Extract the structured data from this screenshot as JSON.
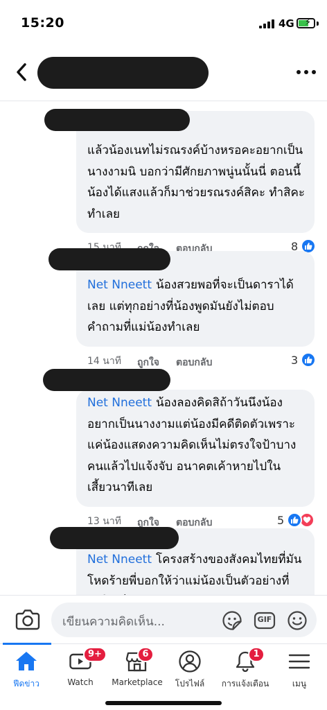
{
  "status_bar": {
    "time": "15:20",
    "network": "4G"
  },
  "comments": [
    {
      "author": "",
      "text": "แล้วน้องเนทไม่รณรงค์บ้างหรอคะอยากเป็นนางงามนิ บอกว่ามีศักยภาพนู่นนั้นนี่ ตอนนี้น้องได้แสงแล้วก็มาช่วยรณรงค์สิคะ ทำสิคะทำเลย",
      "time": "15 นาที",
      "like_label": "ถูกใจ",
      "reply_label": "ตอบกลับ",
      "reaction_count": "8",
      "reactions": [
        "like"
      ]
    },
    {
      "author": "Net Nneett",
      "text": "น้องสวยพอที่จะเป็นดาราได้เลย แต่ทุกอย่างที่น้องพูดมันยังไม่ตอบคำถามที่แม่น้องทำเลย",
      "time": "14 นาที",
      "like_label": "ถูกใจ",
      "reply_label": "ตอบกลับ",
      "reaction_count": "3",
      "reactions": [
        "like"
      ]
    },
    {
      "author": "Net Nneett",
      "text": "น้องลองคิดสิถ้าวันนึงน้องอยากเป็นนางงามแต่น้องมีคดีติดตัวเพราะแค่น้องแสดงความคิดเห็นไม่ตรงใจป้าบางคนแล้วไปแจ้งจับ อนาคตเค้าหายไปในเสี้ยวนาทีเลย",
      "time": "13 นาที",
      "like_label": "ถูกใจ",
      "reply_label": "ตอบกลับ",
      "reaction_count": "5",
      "reactions": [
        "like",
        "love"
      ]
    },
    {
      "author": "Net Nneett",
      "text": "โครงสร้างของสังคมไทยที่มันโหดร้ายพี่บอกให้ว่าแม่น้องเป็นตัวอย่างที่ทำให้เห็นชัดเจน",
      "time": "",
      "like_label": "",
      "reply_label": "",
      "reaction_count": "",
      "reactions": []
    }
  ],
  "composer": {
    "placeholder": "เขียนความคิดเห็น...",
    "gif_label": "GIF"
  },
  "tabs": [
    {
      "label": "ฟีดข่าว",
      "icon": "home-icon",
      "badge": "",
      "active": true
    },
    {
      "label": "Watch",
      "icon": "watch-icon",
      "badge": "9+"
    },
    {
      "label": "Marketplace",
      "icon": "marketplace-icon",
      "badge": "6"
    },
    {
      "label": "โปรไฟล์",
      "icon": "profile-icon",
      "badge": ""
    },
    {
      "label": "การแจ้งเตือน",
      "icon": "bell-icon",
      "badge": "1"
    },
    {
      "label": "เมนู",
      "icon": "menu-icon",
      "badge": ""
    }
  ],
  "colors": {
    "accent": "#1877f2",
    "bubble": "#f0f2f5",
    "author": "#216fdb",
    "badge": "#e41e3f",
    "love": "#f33e58"
  }
}
